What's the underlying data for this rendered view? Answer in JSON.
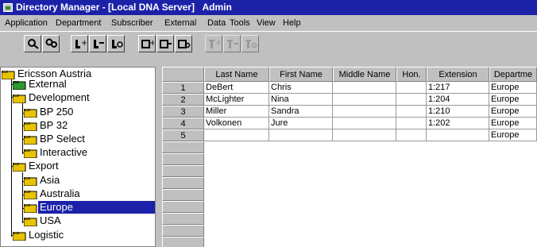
{
  "window": {
    "title": "Directory Manager - [Local DNA Server]",
    "user": "Admin"
  },
  "menu": [
    "Application",
    "Department",
    "Subscriber",
    "External",
    "Data",
    "Tools",
    "View",
    "Help"
  ],
  "toolbar": {
    "buttons": [
      {
        "icon": "find-icon"
      },
      {
        "icon": "find-all-icon"
      },
      {
        "icon": "add-subscriber-icon"
      },
      {
        "icon": "remove-subscriber-icon"
      },
      {
        "icon": "edit-subscriber-icon"
      },
      {
        "icon": "add-department-icon"
      },
      {
        "icon": "remove-department-icon"
      },
      {
        "icon": "edit-department-icon"
      },
      {
        "icon": "add-external-icon"
      },
      {
        "icon": "remove-external-icon"
      },
      {
        "icon": "edit-external-icon"
      }
    ]
  },
  "tree": {
    "nodes": [
      {
        "label": "Ericsson Austria",
        "color": "#e8c400"
      },
      {
        "label": "External",
        "color": "#2a9a2a"
      },
      {
        "label": "Development",
        "color": "#e8c400"
      },
      {
        "label": "BP 250",
        "color": "#e8c400"
      },
      {
        "label": "BP 32",
        "color": "#e8c400"
      },
      {
        "label": "BP Select",
        "color": "#e8c400"
      },
      {
        "label": "Interactive",
        "color": "#e8c400"
      },
      {
        "label": "Export",
        "color": "#e8c400"
      },
      {
        "label": "Asia",
        "color": "#e8c400"
      },
      {
        "label": "Australia",
        "color": "#e8c400"
      },
      {
        "label": "Europe",
        "color": "#e8c400",
        "selected": true
      },
      {
        "label": "USA",
        "color": "#e8c400"
      },
      {
        "label": "Logistic",
        "color": "#e8c400"
      }
    ]
  },
  "grid": {
    "columns": [
      "Last Name",
      "First Name",
      "Middle Name",
      "Hon.",
      "Extension",
      "Departme"
    ],
    "row_numbers": [
      "1",
      "2",
      "3",
      "4",
      "5"
    ],
    "rows": [
      [
        "DeBert",
        "Chris",
        "",
        "",
        "1:217",
        "Europe"
      ],
      [
        "McLighter",
        "Nina",
        "",
        "",
        "1:204",
        "Europe"
      ],
      [
        "Miller",
        "Sandra",
        "",
        "",
        "1:210",
        "Europe"
      ],
      [
        "Volkonen",
        "Jure",
        "",
        "",
        "1:202",
        "Europe"
      ],
      [
        "",
        "",
        "",
        "",
        "",
        "Europe"
      ]
    ]
  },
  "colors": {
    "title_bar": "#1c22a8",
    "selection": "#1c22a8",
    "chrome": "#c0c0c0",
    "folder_yellow": "#e8c400",
    "folder_green": "#2a9a2a"
  }
}
